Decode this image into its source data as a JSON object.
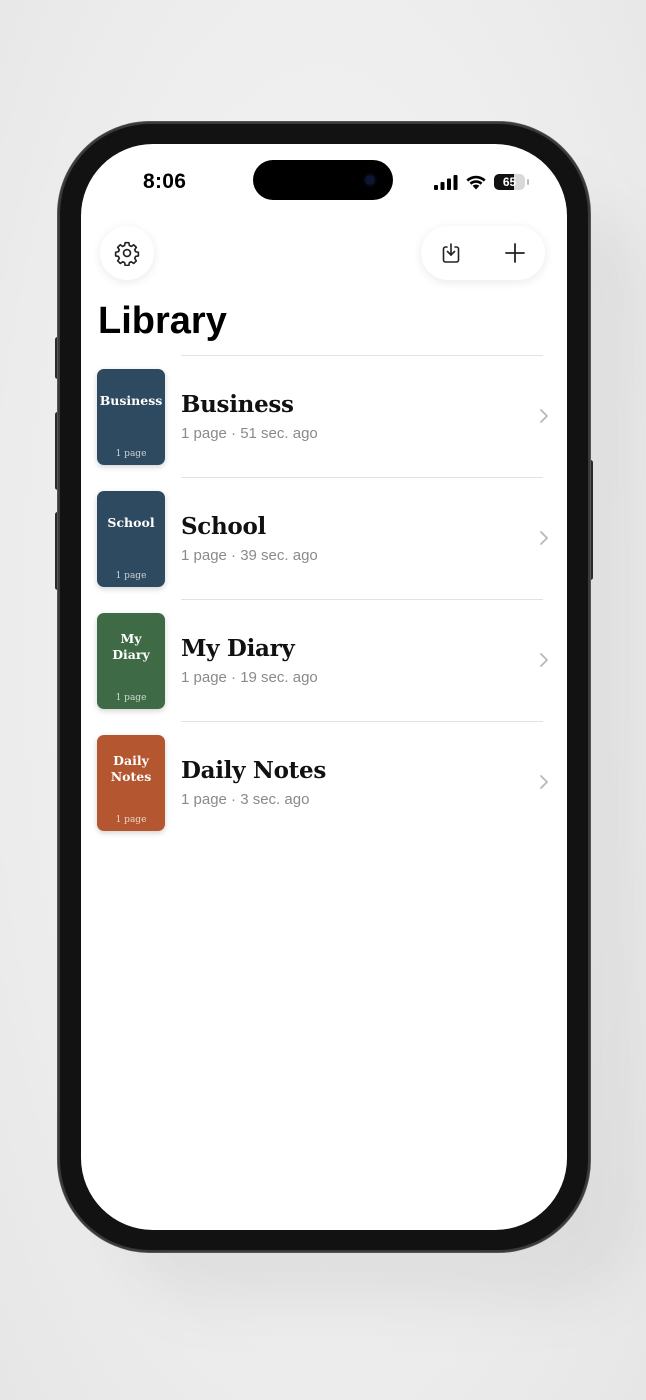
{
  "status": {
    "time": "8:06",
    "battery": "65",
    "battery_fraction": 0.65
  },
  "header": {
    "settings_icon": "gear-icon",
    "import_icon": "tray-download-icon",
    "add_icon": "plus-icon",
    "title": "Library"
  },
  "notebooks": [
    {
      "cover_title": "Business",
      "cover_pages": "1 page",
      "name": "Business",
      "meta": "1 page · 51 sec. ago",
      "color": "#2d4a60"
    },
    {
      "cover_title": "School",
      "cover_pages": "1 page",
      "name": "School",
      "meta": "1 page · 39 sec. ago",
      "color": "#2d4a60"
    },
    {
      "cover_title": "My\nDiary",
      "cover_pages": "1 page",
      "name": "My Diary",
      "meta": "1 page · 19 sec. ago",
      "color": "#3e6b45"
    },
    {
      "cover_title": "Daily\nNotes",
      "cover_pages": "1 page",
      "name": "Daily Notes",
      "meta": "1 page · 3 sec. ago",
      "color": "#b4562f"
    }
  ]
}
